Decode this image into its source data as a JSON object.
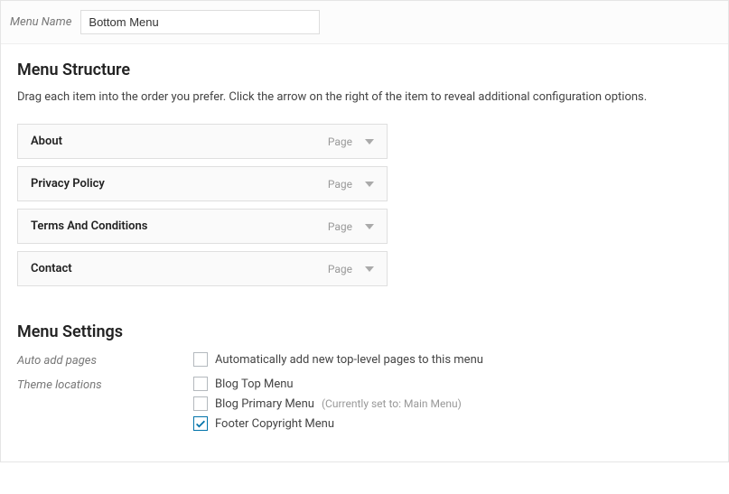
{
  "header": {
    "menu_name_label": "Menu Name",
    "menu_name_value": "Bottom Menu"
  },
  "structure": {
    "title": "Menu Structure",
    "description": "Drag each item into the order you prefer. Click the arrow on the right of the item to reveal additional configuration options.",
    "items": [
      {
        "title": "About",
        "type": "Page"
      },
      {
        "title": "Privacy Policy",
        "type": "Page"
      },
      {
        "title": "Terms And Conditions",
        "type": "Page"
      },
      {
        "title": "Contact",
        "type": "Page"
      }
    ]
  },
  "settings": {
    "title": "Menu Settings",
    "auto_add": {
      "label": "Auto add pages",
      "checkbox_label": "Automatically add new top-level pages to this menu",
      "checked": false
    },
    "theme_locations": {
      "label": "Theme locations",
      "options": [
        {
          "label": "Blog Top Menu",
          "checked": false,
          "note": ""
        },
        {
          "label": "Blog Primary Menu",
          "checked": false,
          "note": "(Currently set to: Main Menu)"
        },
        {
          "label": "Footer Copyright Menu",
          "checked": true,
          "note": ""
        }
      ]
    }
  }
}
